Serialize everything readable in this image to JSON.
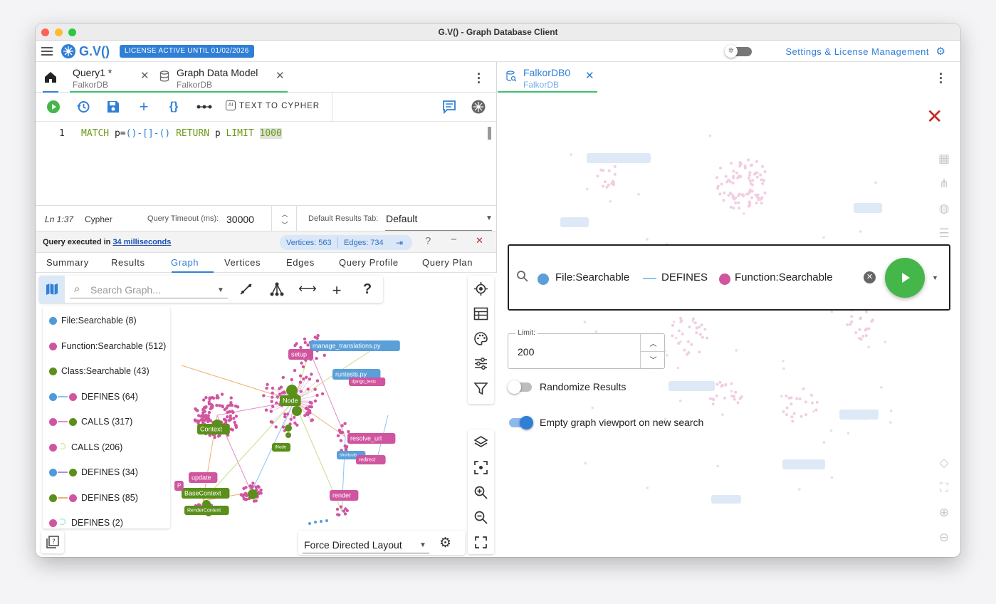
{
  "window": {
    "title": "G.V() - Graph Database Client"
  },
  "appbar": {
    "logo": "G.V()",
    "license": "LICENSE ACTIVE UNTIL 01/02/2026",
    "settings_label": "Settings & License Management"
  },
  "left_tabs": [
    {
      "title": "Query1 *",
      "subtitle": "FalkorDB"
    },
    {
      "title": "Graph Data Model",
      "subtitle": "FalkorDB"
    }
  ],
  "toolbar": {
    "text_to_cypher": "TEXT TO CYPHER"
  },
  "editor": {
    "line_number": "1",
    "tokens": {
      "kw1": "MATCH",
      "p1": " p=",
      "pat": "()-[]-()",
      "kw2": " RETURN",
      "p2": " p ",
      "kw3": "LIMIT",
      "sp": " ",
      "num": "1000"
    }
  },
  "status": {
    "position": "Ln 1:37",
    "language": "Cypher",
    "timeout_label": "Query Timeout (ms):",
    "timeout_value": "30000",
    "default_tab_label": "Default Results Tab:",
    "default_tab_value": "Default"
  },
  "results": {
    "exec_prefix": "Query executed in",
    "exec_time": "34 milliseconds",
    "vertices": "Vertices: 563",
    "edges": "Edges: 734",
    "help": "?",
    "minimize": "−",
    "close": "✕"
  },
  "result_tabs": [
    "Summary",
    "Results",
    "Graph",
    "Vertices",
    "Edges",
    "Query Profile",
    "Query Plan"
  ],
  "graph": {
    "search_placeholder": "Search Graph...",
    "layout": "Force Directed Layout",
    "legend": [
      {
        "label": "File:Searchable (8)",
        "from": "#4f9ad8"
      },
      {
        "label": "Function:Searchable (512)",
        "from": "#d0559f"
      },
      {
        "label": "Class:Searchable (43)",
        "from": "#5a8f1a"
      },
      {
        "label": "DEFINES (64)",
        "from": "#4f9ad8",
        "arrow": "#8cc3ef",
        "to": "#d0559f"
      },
      {
        "label": "CALLS (317)",
        "from": "#d0559f",
        "arrow": "#e38cc6",
        "to": "#5a8f1a"
      },
      {
        "label": "CALLS (206)",
        "from": "#d0559f",
        "loop": "#c5e08a"
      },
      {
        "label": "DEFINES (34)",
        "from": "#4f9ad8",
        "arrow": "#b38ae0",
        "to": "#5a8f1a"
      },
      {
        "label": "DEFINES (85)",
        "from": "#5a8f1a",
        "arrow": "#f0b070",
        "to": "#d0559f"
      },
      {
        "label": "DEFINES (2)",
        "from": "#d0559f",
        "loop": "#8cd8d8"
      }
    ],
    "node_labels": {
      "manage": "manage_translations.py",
      "setup": "setup",
      "runtests": "runtests.py",
      "django": "django_tests",
      "node": "Node",
      "context": "Context",
      "tnode": "tNode",
      "resolve": "resolve_url",
      "shortcuts": "shortcuts",
      "redirect": "redirect",
      "update": "update",
      "base": "BaseContext",
      "render_ctx": "RenderContext",
      "render": "render",
      "p": "P"
    }
  },
  "right_tab": {
    "title": "FalkorDB0",
    "subtitle": "FalkorDB"
  },
  "search": {
    "chip1": "File:Searchable",
    "chip2": "DEFINES",
    "chip3": "Function:Searchable"
  },
  "limit": {
    "label": "Limit:",
    "value": "200"
  },
  "options": {
    "randomize": "Randomize Results",
    "empty_viewport": "Empty graph viewport on new search"
  },
  "colors": {
    "accent": "#2f7fd6",
    "run": "#45b649",
    "close_red": "#c62828"
  }
}
